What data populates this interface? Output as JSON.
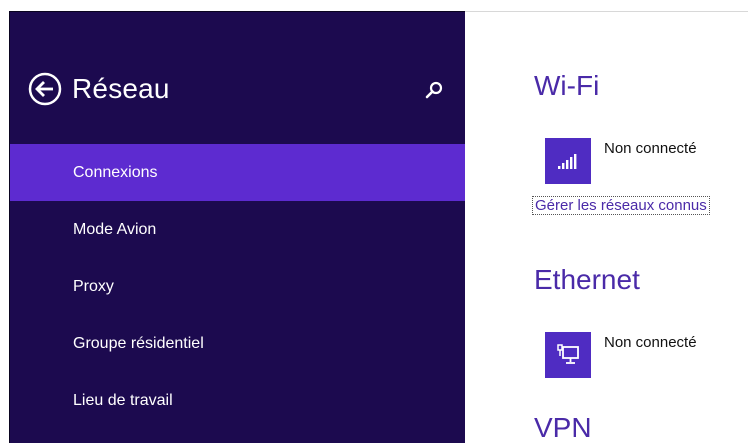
{
  "sidebar": {
    "title": "Réseau",
    "items": [
      {
        "label": "Connexions",
        "selected": true
      },
      {
        "label": "Mode Avion",
        "selected": false
      },
      {
        "label": "Proxy",
        "selected": false
      },
      {
        "label": "Groupe résidentiel",
        "selected": false
      },
      {
        "label": "Lieu de travail",
        "selected": false
      }
    ]
  },
  "content": {
    "wifi": {
      "title": "Wi-Fi",
      "status": "Non connecté",
      "manage_link": "Gérer les réseaux connus",
      "icon": "wifi-signal-icon"
    },
    "ethernet": {
      "title": "Ethernet",
      "status": "Non connecté",
      "icon": "ethernet-icon"
    },
    "vpn": {
      "title": "VPN"
    }
  },
  "colors": {
    "sidebar_bg": "#1c0a4f",
    "selected_bg": "#5d2bd0",
    "accent": "#4a2aa8",
    "tile_bg": "#4f2cc2"
  }
}
